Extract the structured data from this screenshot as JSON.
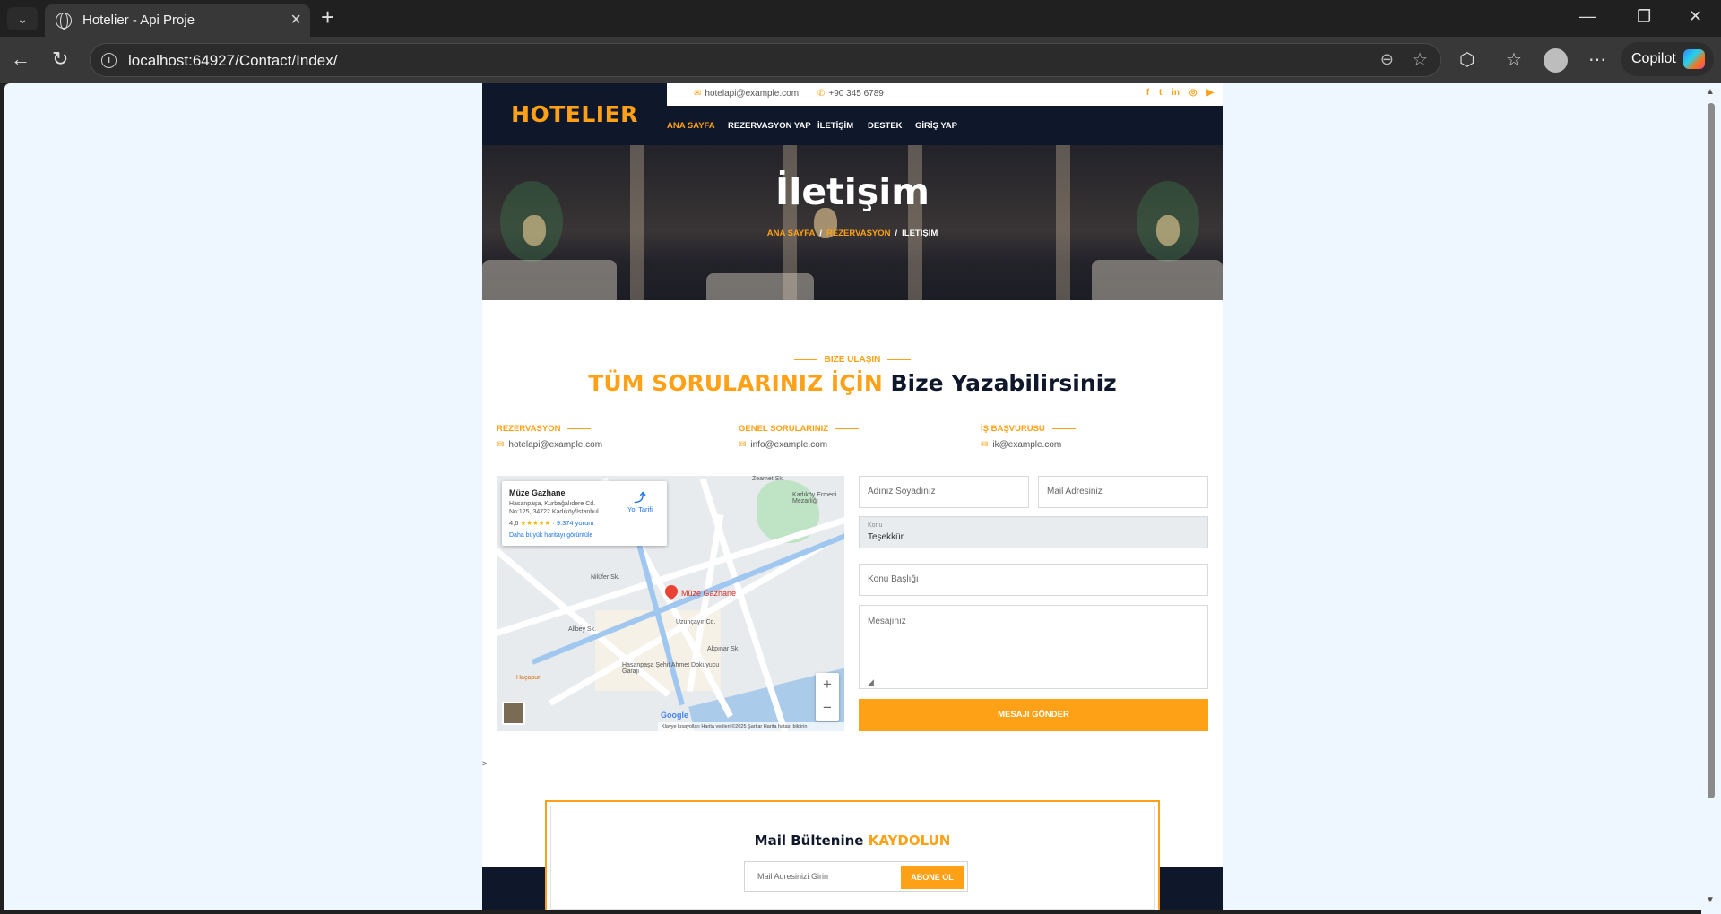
{
  "browser": {
    "tab_title": "Hotelier - Api Proje",
    "url": "localhost:64927/Contact/Index/",
    "copilot_label": "Copilot"
  },
  "site": {
    "brand": "HOTELIER",
    "email": "hotelapi@example.com",
    "phone": "+90 345 6789",
    "menu": [
      "ANA SAYFA",
      "REZERVASYON YAP",
      "İLETİŞİM",
      "DESTEK",
      "GİRİŞ YAP"
    ]
  },
  "hero": {
    "title": "İletişim",
    "breadcrumb": [
      "ANA SAYFA",
      "REZERVASYON",
      "İLETİŞİM"
    ],
    "separator": "/"
  },
  "contact_section": {
    "subtitle": "BIZE ULAŞIN",
    "heading_highlight": "TÜM SORULARINIZ İÇİN",
    "heading_rest": "Bize Yazabilirsiniz",
    "columns": [
      {
        "label": "REZERVASYON",
        "value": "hotelapi@example.com"
      },
      {
        "label": "GENEL SORULARINIZ",
        "value": "info@example.com"
      },
      {
        "label": "İŞ BAŞVURUSU",
        "value": "ik@example.com"
      }
    ]
  },
  "map": {
    "place_name": "Müze Gazhane",
    "address": "Hasanpaşa, Kurbağalıdere Cd. No:125, 34722 Kadıköy/İstanbul",
    "rating": "4,6",
    "stars": "★★★★★",
    "reviews": "9.374 yorum",
    "larger_map": "Daha büyük haritayı görüntüle",
    "directions": "Yol Tarifi",
    "pin_label": "Müze Gazhane",
    "labels": [
      "Zeamet Sk.",
      "Kadıköy Ermeni Mezarlığı",
      "Hasanpaşa Şehit Ahmet Dokuyucu Garajı",
      "Haçapuri",
      "Allbey Sk.",
      "Uzunçayır Cd.",
      "Nilüfer Sk.",
      "Akpınar Sk."
    ],
    "footer": "Klavye kısayolları   Harita verileri ©2025   Şartlar   Harita hatası bildirin",
    "google": "Google"
  },
  "form": {
    "name_placeholder": "Adınız Soyadınız",
    "email_placeholder": "Mail Adresiniz",
    "subject_caption": "Konu",
    "subject_value": "Teşekkür",
    "title_placeholder": "Konu Başlığı",
    "message_placeholder": "Mesajınız",
    "submit_label": "MESAJI GÖNDER"
  },
  "stray_text": ">",
  "newsletter": {
    "title": "Mail Bültenine",
    "title_highlight": "KAYDOLUN",
    "placeholder": "Mail Adresinizi Girin",
    "button": "ABONE OL"
  },
  "colors": {
    "accent": "#fea116",
    "dark": "#0f172b"
  }
}
